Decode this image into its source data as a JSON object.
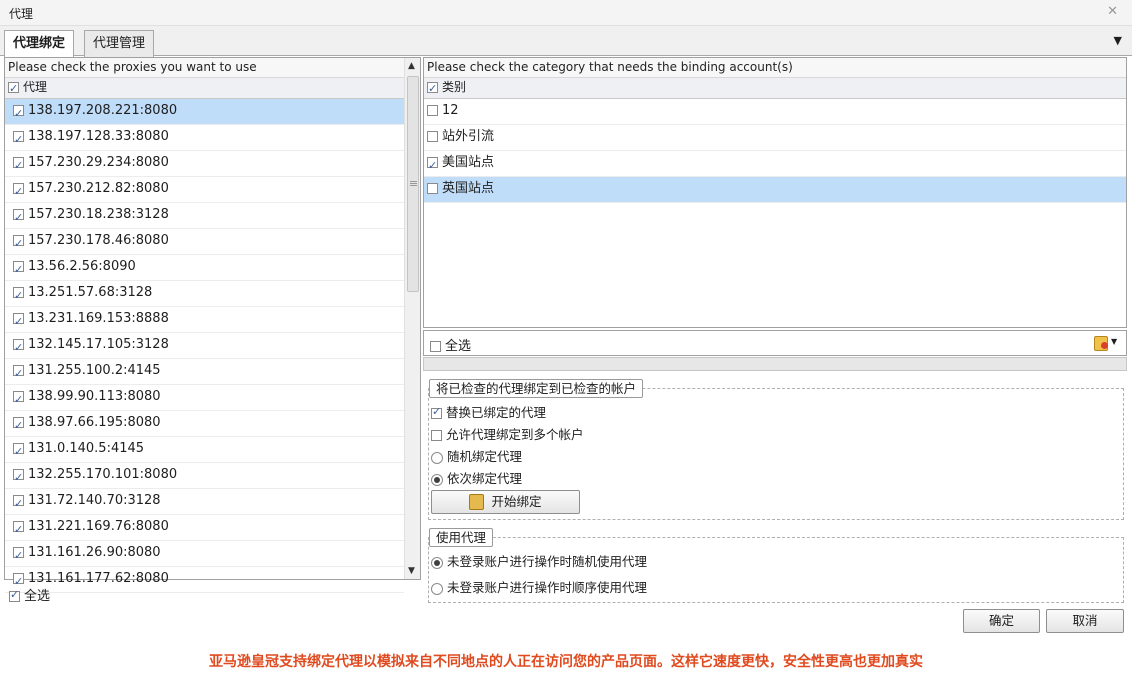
{
  "window": {
    "title": "代理",
    "close_glyph": "✕"
  },
  "tabs": [
    {
      "label": "代理绑定",
      "active": true
    },
    {
      "label": "代理管理",
      "active": false
    }
  ],
  "proxies_panel": {
    "hint": "Please check the proxies you want to use",
    "column_header": "代理",
    "items": [
      {
        "label": "138.197.208.221:8080",
        "checked": true,
        "selected": true
      },
      {
        "label": "138.197.128.33:8080",
        "checked": true
      },
      {
        "label": "157.230.29.234:8080",
        "checked": true
      },
      {
        "label": "157.230.212.82:8080",
        "checked": true
      },
      {
        "label": "157.230.18.238:3128",
        "checked": true
      },
      {
        "label": "157.230.178.46:8080",
        "checked": true
      },
      {
        "label": "13.56.2.56:8090",
        "checked": true
      },
      {
        "label": "13.251.57.68:3128",
        "checked": true
      },
      {
        "label": "13.231.169.153:8888",
        "checked": true
      },
      {
        "label": "132.145.17.105:3128",
        "checked": true
      },
      {
        "label": "131.255.100.2:4145",
        "checked": true
      },
      {
        "label": "138.99.90.113:8080",
        "checked": true
      },
      {
        "label": "138.97.66.195:8080",
        "checked": true
      },
      {
        "label": "131.0.140.5:4145",
        "checked": true
      },
      {
        "label": "132.255.170.101:8080",
        "checked": true
      },
      {
        "label": "131.72.140.70:3128",
        "checked": true
      },
      {
        "label": "131.221.169.76:8080",
        "checked": true
      },
      {
        "label": "131.161.26.90:8080",
        "checked": true
      },
      {
        "label": "131.161.177.62:8080",
        "checked": true
      }
    ],
    "select_all_label": "全选"
  },
  "category_panel": {
    "hint": "Please check the category that needs the binding account(s)",
    "column_header": "类别",
    "items": [
      {
        "label": "12",
        "checked": false
      },
      {
        "label": "站外引流",
        "checked": false
      },
      {
        "label": "美国站点",
        "checked": true
      },
      {
        "label": "英国站点",
        "checked": false,
        "selected": true
      }
    ],
    "select_all_label": "全选"
  },
  "bind_group": {
    "title": "将已检查的代理绑定到已检查的帐户",
    "replace_label": "替换已绑定的代理",
    "allow_multi_label": "允许代理绑定到多个帐户",
    "random_label": "随机绑定代理",
    "sequential_label": "依次绑定代理",
    "start_button": "开始绑定"
  },
  "use_group": {
    "title": "使用代理",
    "random_label": "未登录账户进行操作时随机使用代理",
    "sequential_label": "未登录账户进行操作时顺序使用代理"
  },
  "footer": {
    "ok": "确定",
    "cancel": "取消"
  },
  "caption": "亚马逊皇冠支持绑定代理以模拟来自不同地点的人正在访问您的产品页面。这样它速度更快，安全性更高也更加真实",
  "colors": {
    "selection": "#bfdcf8",
    "caption": "#e04a1f"
  }
}
